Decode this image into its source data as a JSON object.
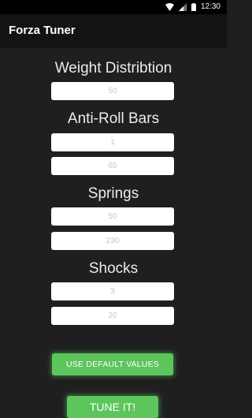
{
  "status_bar": {
    "time": "12:30"
  },
  "app_bar": {
    "title": "Forza Tuner"
  },
  "sections": {
    "weight": {
      "heading": "Weight Distribtion",
      "fields": [
        "50"
      ]
    },
    "arb": {
      "heading": "Anti-Roll Bars",
      "fields": [
        "1",
        "65"
      ]
    },
    "springs": {
      "heading": "Springs",
      "fields": [
        "50",
        "230"
      ]
    },
    "shocks": {
      "heading": "Shocks",
      "fields": [
        "3",
        "20"
      ]
    }
  },
  "buttons": {
    "default_label": "USE DEFAULT VALUES",
    "tune_label": "TUNE IT!"
  },
  "colors": {
    "background": "#1f1f1f",
    "app_bar": "#131313",
    "accent_green": "#5cc55c"
  }
}
